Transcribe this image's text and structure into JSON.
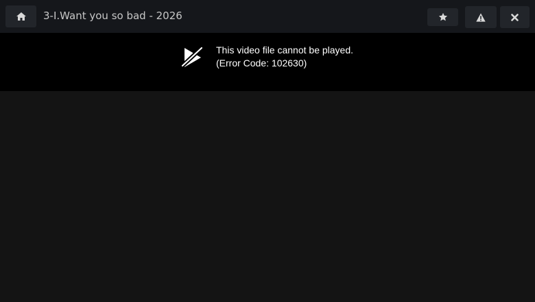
{
  "header": {
    "title": "3-I.Want you so bad - 2026",
    "buttons": {
      "home": {
        "icon": "home-icon"
      },
      "favorite": {
        "icon": "star-icon"
      },
      "report": {
        "icon": "warning-icon"
      },
      "close": {
        "icon": "close-icon"
      }
    }
  },
  "player": {
    "error_icon": "video-unavailable-icon",
    "error_message": "This video file cannot be played.",
    "error_code": "(Error Code: 102630)"
  },
  "colors": {
    "topbar_bg": "#15171b",
    "button_bg": "#22252a",
    "icon_color": "#d9d9d9",
    "player_bg": "#000000",
    "page_bg": "#141414",
    "title_color": "#c7c7c7"
  }
}
